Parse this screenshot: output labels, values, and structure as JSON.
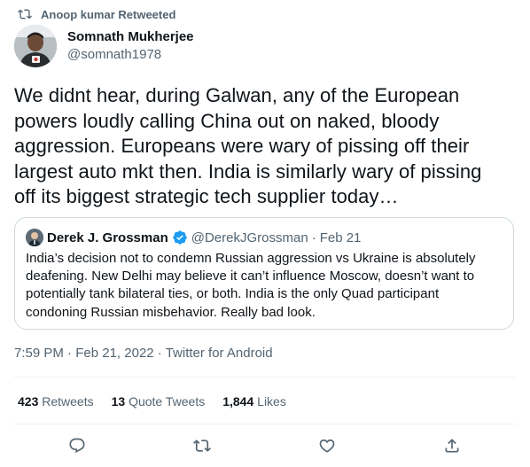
{
  "retweet_context": {
    "text": "Anoop kumar Retweeted"
  },
  "author": {
    "name": "Somnath Mukherjee",
    "handle": "@somnath1978"
  },
  "tweet": {
    "lines": [
      "We didnt hear, during Galwan, any of the European",
      "powers loudly calling China out on naked, bloody",
      "aggression. Europeans were wary of pissing off their",
      "largest auto mkt then. India is similarly wary of pissing",
      "off its biggest strategic tech supplier today…"
    ]
  },
  "quote": {
    "name": "Derek J. Grossman",
    "handle": "@DerekJGrossman",
    "separator": "·",
    "date": "Feb 21",
    "lines": [
      "India’s decision not to condemn Russian aggression vs Ukraine is absolutely",
      "deafening. New Delhi may believe it can’t influence Moscow, doesn’t want to",
      "potentially tank bilateral ties, or both. India is the only Quad participant",
      "condoning Russian misbehavior. Really bad look."
    ]
  },
  "timestamp": {
    "time": "7:59 PM",
    "sep1": "·",
    "date": "Feb 21, 2022",
    "sep2": "·",
    "source": "Twitter for Android"
  },
  "stats": {
    "retweets_count": "423",
    "retweets_label": "Retweets",
    "quote_count": "13",
    "quote_label": "Quote Tweets",
    "likes_count": "1,844",
    "likes_label": "Likes"
  },
  "actions": {
    "reply_icon": "reply-icon",
    "retweet_icon": "retweet-icon",
    "like_icon": "like-icon",
    "share_icon": "share-icon"
  },
  "colors": {
    "text_primary": "#0f1419",
    "text_secondary": "#536471",
    "border": "#cfd9de",
    "verified": "#1d9bf0"
  }
}
